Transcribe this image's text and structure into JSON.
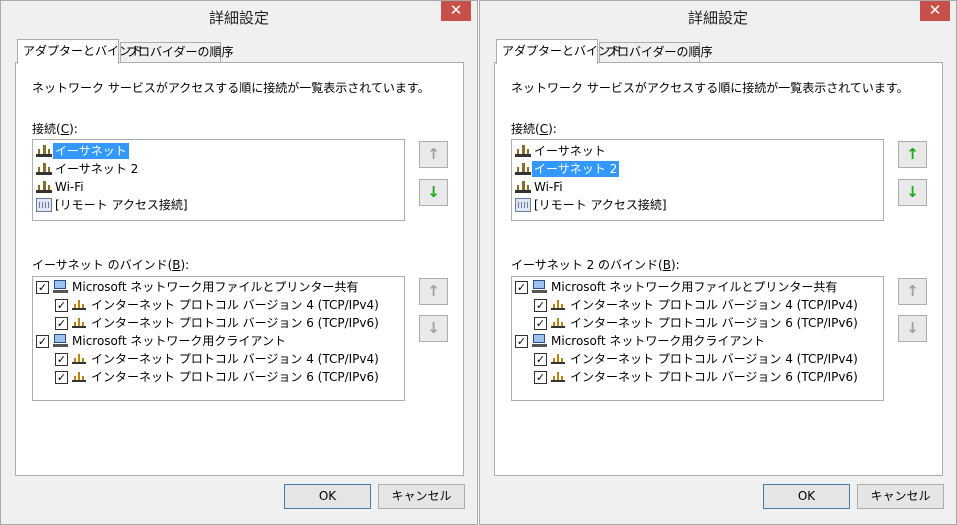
{
  "dialogs": [
    {
      "title": "詳細設定",
      "close_glyph": "✕",
      "tabs": [
        {
          "label": "アダプターとバインド",
          "active": true
        },
        {
          "label": "プロバイダーの順序",
          "active": false
        }
      ],
      "description": "ネットワーク サービスがアクセスする順に接続が一覧表示されています。",
      "connections_label_pre": "接続(",
      "connections_label_key": "C",
      "connections_label_post": "):",
      "connections": [
        {
          "label": "イーサネット",
          "icon": "network-adapter-icon",
          "selected": true
        },
        {
          "label": "イーサネット 2",
          "icon": "network-adapter-icon",
          "selected": false
        },
        {
          "label": "Wi-Fi",
          "icon": "network-adapter-icon",
          "selected": false
        },
        {
          "label": "[リモート アクセス接続]",
          "icon": "remote-access-icon",
          "selected": false
        }
      ],
      "conn_up_enabled": false,
      "conn_down_enabled": true,
      "bindings_label_pre": "イーサネット のバインド(",
      "bindings_label_key": "B",
      "bindings_label_post": "):",
      "bindings": [
        {
          "label": "Microsoft ネットワーク用ファイルとプリンター共有",
          "level": 0,
          "checked": true,
          "icon": "file-printer-sharing-icon"
        },
        {
          "label": "インターネット プロトコル バージョン 4 (TCP/IPv4)",
          "level": 1,
          "checked": true,
          "icon": "protocol-icon"
        },
        {
          "label": "インターネット プロトコル バージョン 6 (TCP/IPv6)",
          "level": 1,
          "checked": true,
          "icon": "protocol-icon"
        },
        {
          "label": "Microsoft ネットワーク用クライアント",
          "level": 0,
          "checked": true,
          "icon": "network-client-icon"
        },
        {
          "label": "インターネット プロトコル バージョン 4 (TCP/IPv4)",
          "level": 1,
          "checked": true,
          "icon": "protocol-icon"
        },
        {
          "label": "インターネット プロトコル バージョン 6 (TCP/IPv6)",
          "level": 1,
          "checked": true,
          "icon": "protocol-icon"
        }
      ],
      "ok_label": "OK",
      "cancel_label": "キャンセル"
    },
    {
      "title": "詳細設定",
      "close_glyph": "✕",
      "tabs": [
        {
          "label": "アダプターとバインド",
          "active": true
        },
        {
          "label": "プロバイダーの順序",
          "active": false
        }
      ],
      "description": "ネットワーク サービスがアクセスする順に接続が一覧表示されています。",
      "connections_label_pre": "接続(",
      "connections_label_key": "C",
      "connections_label_post": "):",
      "connections": [
        {
          "label": "イーサネット",
          "icon": "network-adapter-icon",
          "selected": false
        },
        {
          "label": "イーサネット 2",
          "icon": "network-adapter-icon",
          "selected": true
        },
        {
          "label": "Wi-Fi",
          "icon": "network-adapter-icon",
          "selected": false
        },
        {
          "label": "[リモート アクセス接続]",
          "icon": "remote-access-icon",
          "selected": false
        }
      ],
      "conn_up_enabled": true,
      "conn_down_enabled": true,
      "bindings_label_pre": "イーサネット 2 のバインド(",
      "bindings_label_key": "B",
      "bindings_label_post": "):",
      "bindings": [
        {
          "label": "Microsoft ネットワーク用ファイルとプリンター共有",
          "level": 0,
          "checked": true,
          "icon": "file-printer-sharing-icon"
        },
        {
          "label": "インターネット プロトコル バージョン 4 (TCP/IPv4)",
          "level": 1,
          "checked": true,
          "icon": "protocol-icon"
        },
        {
          "label": "インターネット プロトコル バージョン 6 (TCP/IPv6)",
          "level": 1,
          "checked": true,
          "icon": "protocol-icon"
        },
        {
          "label": "Microsoft ネットワーク用クライアント",
          "level": 0,
          "checked": true,
          "icon": "network-client-icon"
        },
        {
          "label": "インターネット プロトコル バージョン 4 (TCP/IPv4)",
          "level": 1,
          "checked": true,
          "icon": "protocol-icon"
        },
        {
          "label": "インターネット プロトコル バージョン 6 (TCP/IPv6)",
          "level": 1,
          "checked": true,
          "icon": "protocol-icon"
        }
      ],
      "ok_label": "OK",
      "cancel_label": "キャンセル"
    }
  ],
  "arrow_glyphs": {
    "up": "↑",
    "down": "↓"
  },
  "check_glyph": "✓",
  "colors": {
    "selection": "#3399ff",
    "arrow_enabled": "#1aa81a",
    "arrow_disabled": "#a0a0a0",
    "close_button": "#c7504b"
  }
}
